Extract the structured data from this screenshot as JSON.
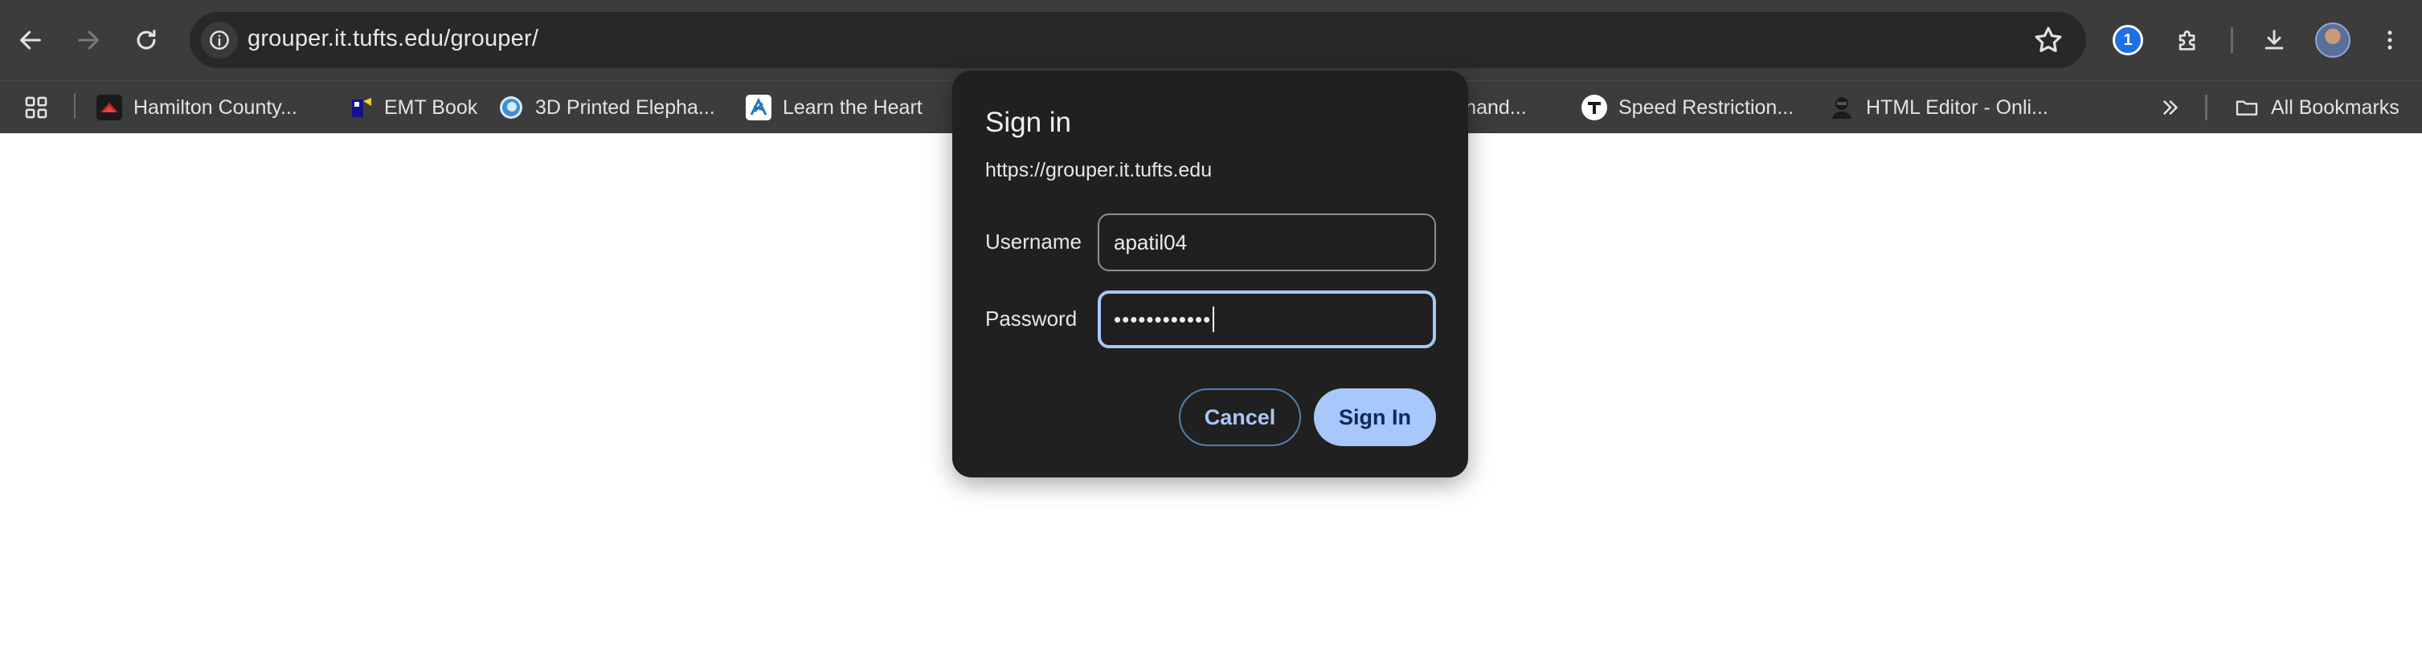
{
  "colors": {
    "chrome_bg": "#3c3c3c",
    "omnibox_bg": "#282828",
    "dialog_bg": "#202020",
    "accent": "#a8c7fa"
  },
  "toolbar": {
    "back_icon": "arrow-left-icon",
    "forward_icon": "arrow-right-icon",
    "reload_icon": "reload-icon",
    "site_info_icon": "site-info-icon",
    "url": "grouper.it.tufts.edu/grouper/",
    "bookmark_icon": "star-icon",
    "extension_1password_icon": "1password-icon",
    "extension_1password_glyph": "1",
    "extensions_icon": "puzzle-icon",
    "downloads_icon": "download-icon",
    "profile_icon": "avatar",
    "menu_icon": "kebab-menu-icon"
  },
  "bookmarks": {
    "apps_icon": "apps-grid-icon",
    "items": [
      {
        "label": "Hamilton County...",
        "icon": "hamilton-county-favicon"
      },
      {
        "label": "EMT Book",
        "icon": "emt-book-favicon"
      },
      {
        "label": "3D Printed Elepha...",
        "icon": "3d-printed-favicon"
      },
      {
        "label": "Learn the Heart",
        "icon": "learn-the-heart-favicon"
      },
      {
        "label": ", Anand...",
        "icon": ""
      },
      {
        "label": "Speed Restriction...",
        "icon": "speed-restriction-favicon"
      },
      {
        "label": "HTML Editor - Onli...",
        "icon": "html-editor-favicon"
      }
    ],
    "overflow_icon": "chevron-double-right-icon",
    "all_bookmarks_label": "All Bookmarks",
    "all_bookmarks_icon": "folder-icon"
  },
  "dialog": {
    "title": "Sign in",
    "origin": "https://grouper.it.tufts.edu",
    "username_label": "Username",
    "username_value": "apatil04",
    "password_label": "Password",
    "password_value": "••••••••••••",
    "cancel_label": "Cancel",
    "signin_label": "Sign In"
  }
}
